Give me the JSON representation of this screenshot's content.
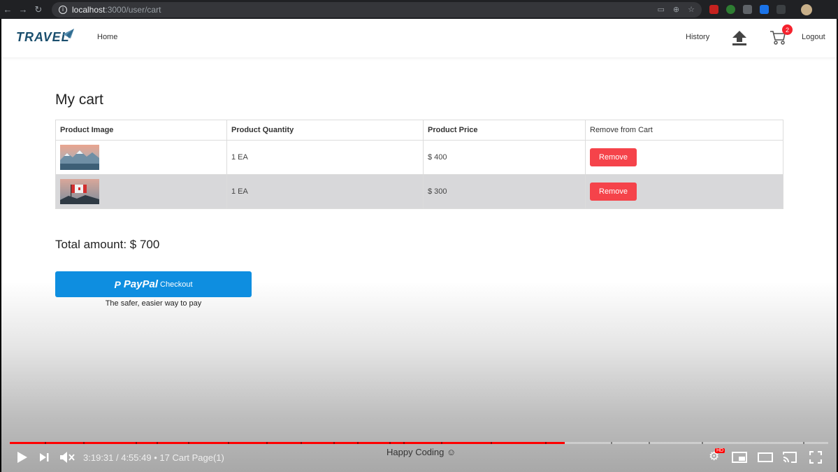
{
  "browser": {
    "url_host": "localhost",
    "url_path": ":3000/user/cart"
  },
  "header": {
    "logo_text": "TRAVEL",
    "nav_home": "Home",
    "nav_history": "History",
    "cart_count": "2",
    "nav_logout": "Logout"
  },
  "main": {
    "title": "My cart",
    "table": {
      "columns": [
        "Product Image",
        "Product Quantity",
        "Product Price",
        "Remove from Cart"
      ],
      "rows": [
        {
          "image": "mountain-lake-photo",
          "quantity": "1 EA",
          "price": "$ 400",
          "remove_label": "Remove"
        },
        {
          "image": "canada-flag-photo",
          "quantity": "1 EA",
          "price": "$ 300",
          "remove_label": "Remove"
        }
      ]
    },
    "total": "Total amount: $ 700",
    "paypal": {
      "mark": "P",
      "word": "PayPal",
      "checkout": "Checkout",
      "tagline": "The safer, easier way to pay"
    }
  },
  "player": {
    "time": "3:19:31 / 4:55:49",
    "chapter": "• 17 Cart Page(1)",
    "caption": "Happy Coding ☺",
    "progress_fraction": 0.678,
    "hd_badge": "HD"
  },
  "colors": {
    "remove": "#f5434a",
    "paypal": "#0e8ee0",
    "badge": "#f5222d",
    "progress": "#ff0000"
  }
}
